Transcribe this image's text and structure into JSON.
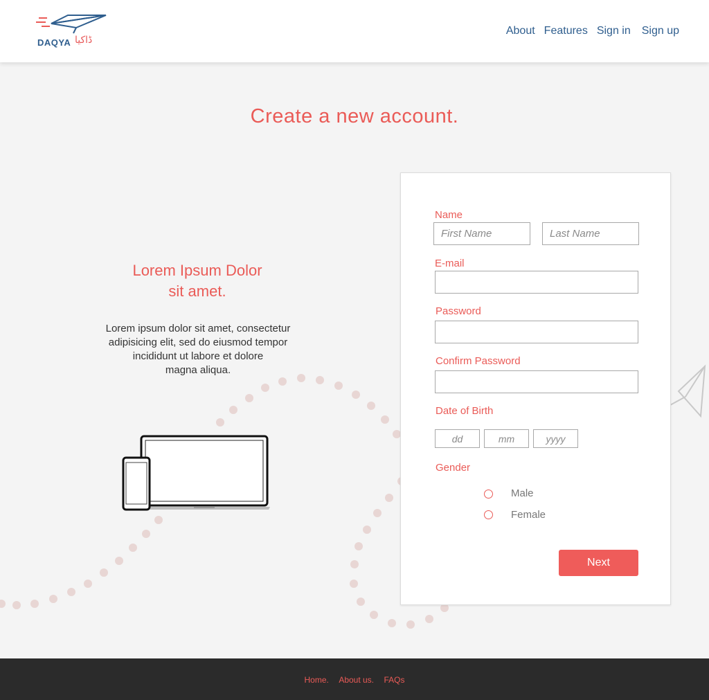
{
  "brand": {
    "name": "DAQYA",
    "name_urdu": "ڈاکیا",
    "primary_color": "#2f5e8e",
    "accent_color": "#ea5b57"
  },
  "nav": {
    "items": [
      "About",
      "Features",
      "Sign in",
      "Sign up"
    ]
  },
  "page": {
    "title": "Create a new account."
  },
  "promo": {
    "heading_line1": "Lorem Ipsum Dolor",
    "heading_line2": "sit amet.",
    "body_lines": [
      "Lorem ipsum dolor sit amet, consectetur",
      "adipisicing elit, sed do eiusmod tempor",
      "incididunt ut labore et dolore",
      "magna aliqua."
    ]
  },
  "form": {
    "name_label": "Name",
    "first_name_placeholder": "First Name",
    "last_name_placeholder": "Last Name",
    "email_label": "E-mail",
    "password_label": "Password",
    "confirm_password_label": "Confirm Password",
    "dob_label": "Date of Birth",
    "dob_day_placeholder": "dd",
    "dob_month_placeholder": "mm",
    "dob_year_placeholder": "yyyy",
    "gender_label": "Gender",
    "gender_options": [
      "Male",
      "Female"
    ],
    "next_label": "Next"
  },
  "footer": {
    "links": [
      "Home.",
      "About us.",
      "FAQs"
    ]
  }
}
